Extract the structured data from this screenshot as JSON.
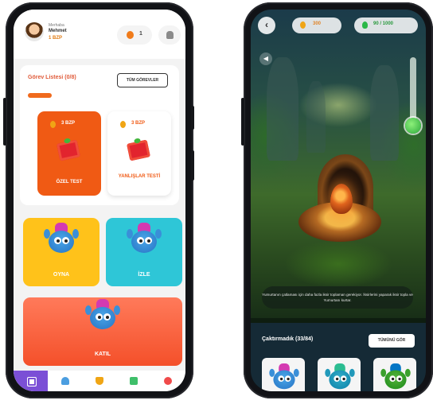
{
  "colors": {
    "accent_orange": "#f06a1d",
    "accent_purple": "#7b4fd6",
    "tile_yellow": "#ffc21a",
    "tile_teal": "#2ec6d7",
    "panel_dark": "#152a36"
  },
  "left_app": {
    "user": {
      "greeting": "Merhaba",
      "name": "Mehmet",
      "coins": "1 BZP"
    },
    "header": {
      "streak_value": "1",
      "streak_icon": "fire-icon",
      "bell_icon": "bell-icon"
    },
    "tasks": {
      "title": "Görev Listesi (0/8)",
      "see_all_label": "TÜM GÖREVLER",
      "progress_fraction": 0.0,
      "items": [
        {
          "reward": "3 BZP",
          "label": "ÖZEL TEST",
          "style": "filled"
        },
        {
          "reward": "3 BZP",
          "label": "YANLIŞLAR TESTİ",
          "style": "white"
        }
      ]
    },
    "tiles": {
      "play_label": "OYNA",
      "watch_label": "İZLE",
      "join_label": "KATIL"
    },
    "bottom_nav": [
      {
        "icon": "grid-icon",
        "active": true
      },
      {
        "icon": "trophy-icon",
        "active": false
      },
      {
        "icon": "cup-icon",
        "active": false
      },
      {
        "icon": "book-icon",
        "active": false
      },
      {
        "icon": "record-icon",
        "active": false
      }
    ]
  },
  "right_app": {
    "header": {
      "back_icon": "back-arrow-icon",
      "coin_value": "300",
      "potion_value": "90 / 1000"
    },
    "sound_icon": "speaker-icon",
    "info_text": "Yumurtanın çatlaması için daha fazla iksir toplaman gerekiyor. İksirlerini yaparak iksir topla ve Yumurtanı kurtar.",
    "creatures": {
      "title": "Çaktırmadık (33/84)",
      "see_all_label": "TÜMÜNÜ GÖR"
    }
  }
}
